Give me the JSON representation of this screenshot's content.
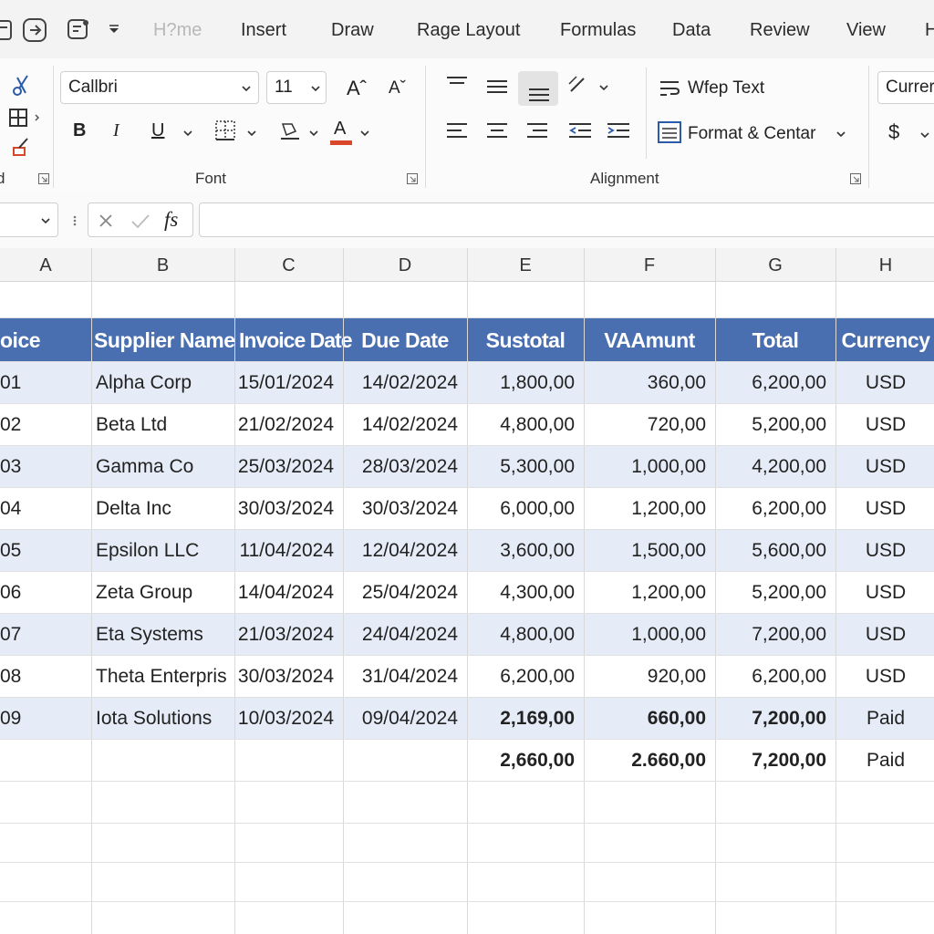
{
  "tabs": [
    "H?me",
    "Insert",
    "Draw",
    "Rage Layout",
    "Formulas",
    "Data",
    "Review",
    "View",
    "H"
  ],
  "ribbon": {
    "font_name": "Callbri",
    "font_size": "11",
    "grow_font": "Aˆ",
    "shrink_font": "Aˇ",
    "bold": "B",
    "italic": "I",
    "underline": "U",
    "font_color_glyph": "A",
    "font_group_label": "Font",
    "clipboard_label": "d",
    "wrap_text": "Wfep Text",
    "merge_center": "Format & Centar",
    "alignment_group_label": "Alignment",
    "number_format": "Currer",
    "currency_symbol": "$"
  },
  "formula_bar": {
    "fx_label": "fs",
    "value": ""
  },
  "columns": [
    "A",
    "B",
    "C",
    "D",
    "E",
    "F",
    "G",
    "H"
  ],
  "table": {
    "headers": [
      "oice",
      "Supplier Name",
      "Invoice Date",
      "Due Date",
      "Sustotal",
      "VAAmunt",
      "Total",
      "Currency"
    ],
    "rows": [
      [
        "01",
        "Alpha Corp",
        "15/01/2024",
        "14/02/2024",
        "1,800,00",
        "360,00",
        "6,200,00",
        "USD"
      ],
      [
        "02",
        "Beta Ltd",
        "21/02/2024",
        "14/02/2024",
        "4,800,00",
        "720,00",
        "5,200,00",
        "USD"
      ],
      [
        "03",
        "Gamma Co",
        "25/03/2024",
        "28/03/2024",
        "5,300,00",
        "1,000,00",
        "4,200,00",
        "USD"
      ],
      [
        "04",
        "Delta Inc",
        "30/03/2024",
        "30/03/2024",
        "6,000,00",
        "1,200,00",
        "6,200,00",
        "USD"
      ],
      [
        "05",
        "Epsilon LLC",
        "11/04/2024",
        "12/04/2024",
        "3,600,00",
        "1,500,00",
        "5,600,00",
        "USD"
      ],
      [
        "06",
        "Zeta Group",
        "14/04/2024",
        "25/04/2024",
        "4,300,00",
        "1,200,00",
        "5,200,00",
        "USD"
      ],
      [
        "07",
        "Eta Systems",
        "21/03/2024",
        "24/04/2024",
        "4,800,00",
        "1,000,00",
        "7,200,00",
        "USD"
      ],
      [
        "08",
        "Theta Enterpris",
        "30/03/2024",
        "31/04/2024",
        "6,200,00",
        "920,00",
        "6,200,00",
        "USD"
      ],
      [
        "09",
        "Iota Solutions",
        "10/03/2024",
        "09/04/2024",
        "2,169,00",
        "660,00",
        "7,200,00",
        "Paid"
      ]
    ],
    "totals": [
      "",
      "",
      "",
      "",
      "2,660,00",
      "2.660,00",
      "7,200,00",
      "Paid"
    ]
  },
  "colors": {
    "header_fill": "#4a6fb0",
    "band_fill": "#e6ecf7",
    "font_color_bar": "#d9472b"
  }
}
